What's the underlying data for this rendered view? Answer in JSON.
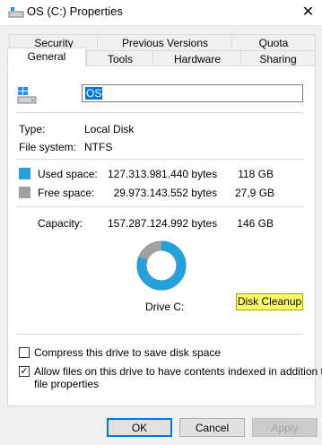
{
  "window": {
    "title": "OS (C:) Properties",
    "close_glyph": "✕"
  },
  "tabs": {
    "back_row": [
      "Security",
      "Previous Versions",
      "Quota"
    ],
    "front_row": [
      "General",
      "Tools",
      "Hardware",
      "Sharing"
    ],
    "active": "General"
  },
  "general": {
    "drive_name": "OS",
    "type_label": "Type:",
    "type_value": "Local Disk",
    "fs_label": "File system:",
    "fs_value": "NTFS",
    "used_label": "Used space:",
    "used_bytes": "127.313.981.440 bytes",
    "used_size": "118 GB",
    "free_label": "Free space:",
    "free_bytes": "29.973.143.552 bytes",
    "free_size": "27,9 GB",
    "capacity_label": "Capacity:",
    "capacity_bytes": "157.287.124.992 bytes",
    "capacity_size": "146 GB",
    "drive_label": "Drive C:",
    "used_fraction": 0.809,
    "cleanup_label": "Disk Cleanup",
    "compress_label": "Compress this drive to save disk space",
    "compress_checked": false,
    "index_label_line1": "Allow files on this drive to have contents indexed in addition to",
    "index_label_line2": "file properties",
    "index_checked": true
  },
  "buttons": {
    "ok": "OK",
    "cancel": "Cancel",
    "apply": "Apply"
  },
  "colors": {
    "used": "#26a0da",
    "free": "#a0a0a0",
    "highlight": "#ffff66"
  }
}
